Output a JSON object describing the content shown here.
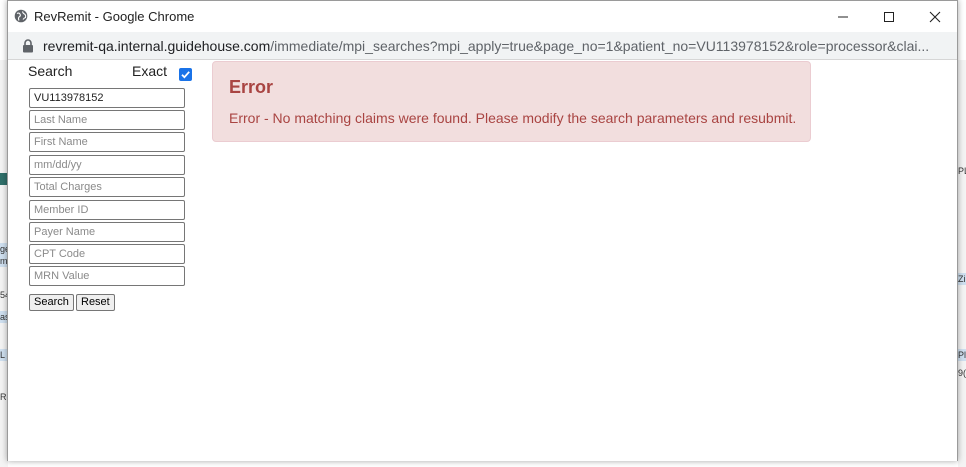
{
  "window": {
    "title": "RevRemit - Google Chrome",
    "url_host": "revremit-qa.internal.guidehouse.com",
    "url_path": "/immediate/mpi_searches?mpi_apply=true&page_no=1&patient_no=VU113978152&role=processor&clai..."
  },
  "search_panel": {
    "search_label": "Search",
    "exact_label": "Exact",
    "exact_checked": true,
    "patient_no_value": "VU113978152",
    "placeholders": {
      "last_name": "Last Name",
      "first_name": "First Name",
      "date": "mm/dd/yy",
      "total_charges": "Total Charges",
      "member_id": "Member ID",
      "payer_name": "Payer Name",
      "cpt_code": "CPT Code",
      "mrn_value": "MRN Value"
    },
    "search_button": "Search",
    "reset_button": "Reset"
  },
  "alert": {
    "title": "Error",
    "message": "Error - No matching claims were found. Please modify the search parameters and resubmit.",
    "color": "#a94442",
    "background": "#f2dede"
  },
  "background_fragments": {
    "left": [
      "ge",
      "m",
      "54",
      "as",
      "L",
      "Re"
    ],
    "right": [
      "PL",
      "Zi",
      "Pl",
      "9("
    ]
  }
}
